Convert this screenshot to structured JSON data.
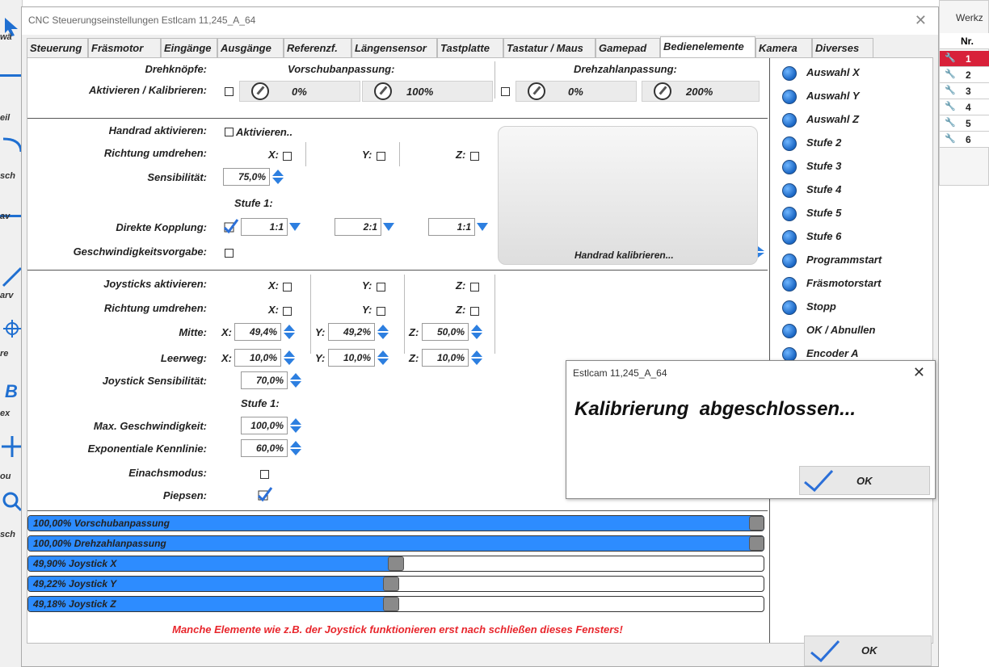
{
  "left_strip": {
    "texts": [
      "wä",
      "eil",
      "sch",
      "av",
      "arv",
      "re",
      "ex",
      "ou",
      "sch"
    ]
  },
  "bg_window": {
    "title": "Werkz",
    "col_header": "Nr.",
    "rows": [
      "1",
      "2",
      "3",
      "4",
      "5",
      "6"
    ]
  },
  "window": {
    "title": "CNC Steuerungseinstellungen Estlcam 11,245_A_64",
    "close": "✕"
  },
  "tabs": [
    "Steuerung",
    "Fräsmotor",
    "Eingänge",
    "Ausgänge",
    "Referenzf.",
    "Längensensor",
    "Tastplatte",
    "Tastatur / Maus",
    "Gamepad",
    "Bedienelemente",
    "Kamera",
    "Diverses"
  ],
  "knobs": {
    "label": "Drehknöpfe:",
    "activate_label": "Aktivieren / Kalibrieren:",
    "feed_title": "Vorschubanpassung:",
    "speed_title": "Drehzahlanpassung:",
    "feed_min": "0%",
    "feed_max": "100%",
    "speed_min": "0%",
    "speed_max": "200%"
  },
  "handwheel": {
    "activate_label": "Handrad aktivieren:",
    "activate_cb": "Aktivieren..",
    "direction_label": "Richtung umdrehen:",
    "x": "X:",
    "y": "Y:",
    "z": "Z:",
    "sensitivity_label": "Sensibilität:",
    "sensitivity": "75,0%",
    "stage": "Stufe 1:",
    "coupling_label": "Direkte Kopplung:",
    "ratio_x": "1:1",
    "ratio_y": "2:1",
    "ratio_z": "1:1",
    "speed_label": "Geschwindigkeitsvorgabe:",
    "calibrate": "Handrad kalibrieren..."
  },
  "joystick": {
    "activate_label": "Joysticks aktivieren:",
    "direction_label": "Richtung umdrehen:",
    "center_label": "Mitte:",
    "deadband_label": "Leerweg:",
    "x": "X:",
    "y": "Y:",
    "z": "Z:",
    "center_x": "49,4%",
    "center_y": "49,2%",
    "center_z": "50,0%",
    "dead_x": "10,0%",
    "dead_y": "10,0%",
    "dead_z": "10,0%",
    "sens_label": "Joystick Sensibilität:",
    "sens": "70,0%",
    "stage": "Stufe 1:",
    "maxspeed_label": "Max. Geschwindigkeit:",
    "maxspeed": "100,0%",
    "expo_label": "Exponentiale Kennlinie:",
    "expo": "60,0%",
    "single_axis_label": "Einachsmodus:",
    "beep_label": "Piepsen:"
  },
  "right_buttons": [
    "Auswahl X",
    "Auswahl Y",
    "Auswahl Z",
    "Stufe 2",
    "Stufe 3",
    "Stufe 4",
    "Stufe 5",
    "Stufe 6",
    "Programmstart",
    "Fräsmotorstart",
    "Stopp",
    "OK / Abnullen",
    "Encoder A"
  ],
  "bars": [
    {
      "label": "100,00% Vorschubanpassung",
      "value": 1.0
    },
    {
      "label": "100,00% Drehzahlanpassung",
      "value": 1.0
    },
    {
      "label": "49,90% Joystick X",
      "value": 0.499
    },
    {
      "label": "49,22% Joystick Y",
      "value": 0.4922
    },
    {
      "label": "49,18% Joystick Z",
      "value": 0.4918
    }
  ],
  "warning": "Manche Elemente wie z.B. der Joystick funktionieren erst nach schließen dieses Fensters!",
  "colors": {
    "warning": "#e8262c",
    "bar_fill": "#2d8cff",
    "check": "#2b6fd8",
    "active_row": "#d8213a"
  },
  "ok": "OK",
  "dialog": {
    "title": "Estlcam 11,245_A_64",
    "close": "✕",
    "message": "Kalibrierung  abgeschlossen...",
    "ok": "OK"
  }
}
